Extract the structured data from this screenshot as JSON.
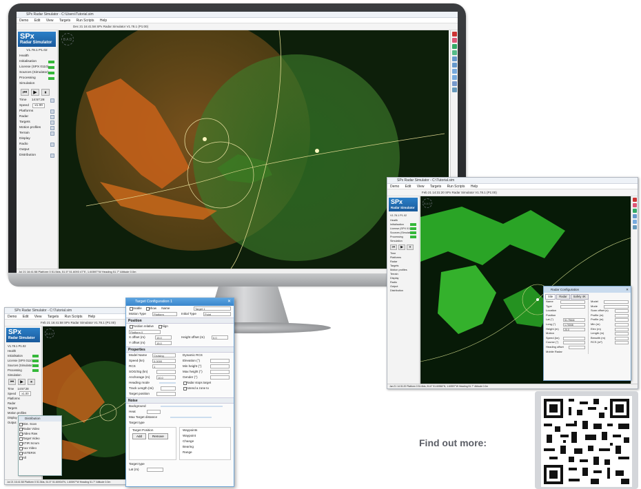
{
  "marketing": {
    "find_out_more": "Find out more:"
  },
  "main_window": {
    "title": "SPx Radar Simulator - C:\\Users\\Tutorial.sim",
    "menu": [
      "Demo",
      "Edit",
      "View",
      "Targets",
      "Run Scripts",
      "Help"
    ],
    "toolbar_text": "Dec 21 16:41:58   SPx Radar Simulator V1.78.1 (P1:00)",
    "logo_main": "SPx",
    "logo_sub": "Radar Simulator",
    "version": "V1.78.1 P1.02",
    "health_label": "Health",
    "health": [
      {
        "label": "Initialisation"
      },
      {
        "label": "License (SPX 0110)"
      },
      {
        "label": "Sources (Simulator)"
      }
    ],
    "processing_label": "Processing",
    "simulation_label": "Simulation",
    "time_label": "Time",
    "time_value": "14:57:28",
    "speed_label": "Speed",
    "speed_value": "x1.00",
    "sidebar_items": [
      "Platforms",
      "Radar",
      "Targets",
      "Motion profiles",
      "Terrain"
    ],
    "display_label": "Display",
    "radio_label": "Radio",
    "output_label": "Output",
    "distribution_label": "Distribution",
    "status_bar": "Jul 21 16:41:58    Platform 0    51.5kts, 51.5° 51.6093 47°E, 1.60597°W    Heading 51.7°    Altitude 0.0m",
    "compass_letters": "B A D"
  },
  "green_window": {
    "title": "SPx Radar Simulator - C:\\Tutorial.sim",
    "menu": [
      "Demo",
      "Edit",
      "View",
      "Targets",
      "Run Scripts",
      "Help"
    ],
    "toolbar_text": "Feb 21 14:31:20   SPx Radar Simulator V1.78.1 (P1:00)",
    "status_bar": "Jan 21 14:31:20   Platform 0   51.6kts, 51.6° 51.60584°N, 1.60597°W   Heading 51.7°   Altitude 0.0m"
  },
  "radar_dialog": {
    "title": "Radar Configuration",
    "tabs": [
      "Site",
      "Radar",
      "Safety 4K"
    ],
    "rows": [
      "Name",
      "Type",
      "Location",
      "Position",
      "Lat (°)",
      "Long (°)",
      "Height (m)",
      "Motion",
      "Speed (kn)",
      "Course (°)",
      "Heading offset",
      "Mobile Radar"
    ],
    "right_rows": [
      "Model",
      "Mode",
      "Scan offset (s)",
      "Profile (m)",
      "Profile (m)",
      "Min (m)",
      "Elev (m)",
      "Length (m)",
      "Breadth (m)",
      "RCS (m²)"
    ],
    "values": {
      "lat": "51.75644",
      "long": "1.70008",
      "height": "20.0"
    }
  },
  "small_window": {
    "title": "SPx Radar Simulator - C:\\Tutorial.sim",
    "menu": [
      "Demo",
      "Edit",
      "View",
      "Targets",
      "Run Scripts",
      "Help"
    ],
    "toolbar_text": "Feb 21 16:41:58   SPx Radar Simulator V1.78.1 (P1:00)",
    "time_value": "14:57:28",
    "speed_value": "x1.00",
    "status_bar": "Jul 21 16:41:58   Platform 0   51.5kts, 51.5°   51.60934°N, 1.60597°W   Heading 51.7°   Altitude 0.0m"
  },
  "target_dialog": {
    "title": "Target Configuration 1",
    "top": {
      "enable": "Enable",
      "show": "Show",
      "name_label": "Name",
      "name_value": "Target 1",
      "motion_type_label": "Motion Type",
      "motion_type_value": "Platform",
      "initial_type_label": "Initial Type",
      "initial_value": "Point"
    },
    "sections": {
      "position": "Position",
      "properties": "Properties",
      "noise": "Noise"
    },
    "position_rows": [
      "Position relative",
      "Align",
      "Platform 0",
      "X offset (m)",
      "Y offset (m)",
      "Height offset (m)"
    ],
    "position_values": {
      "x": "15.0",
      "y": "15.0",
      "h": "0.0"
    },
    "properties_rows": [
      "Model Name",
      "Speed (kn)",
      "RCS",
      "SOG/Sig (kn)",
      "Anchorage (m)",
      "Heading mode",
      "Track Length (mi)",
      "Target position"
    ],
    "properties_values": {
      "model": "Cruising",
      "speed": "0.0000",
      "rcs": "1",
      "anchor": "10.0"
    },
    "properties_right": [
      "Dynamic RCS",
      "Elevation (°)",
      "Min height (°)",
      "Max height (°)",
      "Gender (°)",
      "Radar stops target",
      "Extend a zone to"
    ],
    "noise_rows": [
      "Background",
      "Heat",
      "Max Target distance",
      "Target type"
    ],
    "tpos_label": "Target Position",
    "buttons": {
      "add": "Add",
      "remove": "Remove"
    },
    "rows_label": "Waypoints",
    "waypoint_cols": [
      "Waypoint",
      "Change",
      "Bearing",
      "Range"
    ],
    "footer": [
      "Target type",
      "Lat (m)"
    ]
  },
  "distribution_popup": {
    "title": "Distribution",
    "items": [
      "Dist. Scan",
      "Radar Video",
      "Video Raw",
      "Target Video",
      "STIR Scrum",
      "Aux Video",
      "ASTERIX",
      "All"
    ]
  }
}
